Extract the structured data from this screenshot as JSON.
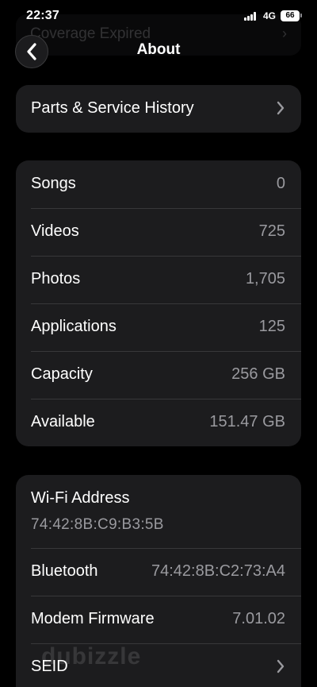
{
  "status_bar": {
    "time": "22:37",
    "network": "4G",
    "battery": "66"
  },
  "ghost_row": {
    "label": "Coverage Expired",
    "chevron": "›"
  },
  "nav": {
    "back_icon": "chevron-left-icon",
    "title": "About"
  },
  "service_group": {
    "label": "Parts & Service History",
    "chevron_icon": "chevron-right-icon"
  },
  "stats": [
    {
      "label": "Songs",
      "value": "0"
    },
    {
      "label": "Videos",
      "value": "725"
    },
    {
      "label": "Photos",
      "value": "1,705"
    },
    {
      "label": "Applications",
      "value": "125"
    },
    {
      "label": "Capacity",
      "value": "256 GB"
    },
    {
      "label": "Available",
      "value": "151.47 GB"
    }
  ],
  "network_info": {
    "wifi": {
      "label": "Wi-Fi Address",
      "value": "74:42:8B:C9:B3:5B"
    },
    "bluetooth": {
      "label": "Bluetooth",
      "value": "74:42:8B:C2:73:A4"
    },
    "modem": {
      "label": "Modem Firmware",
      "value": "7.01.02"
    },
    "seid": {
      "label": "SEID"
    }
  },
  "watermark": "dubizzle",
  "colors": {
    "background": "#000000",
    "card": "#1c1c1e",
    "separator": "#38383a",
    "secondary_text": "#9a9a9f"
  }
}
